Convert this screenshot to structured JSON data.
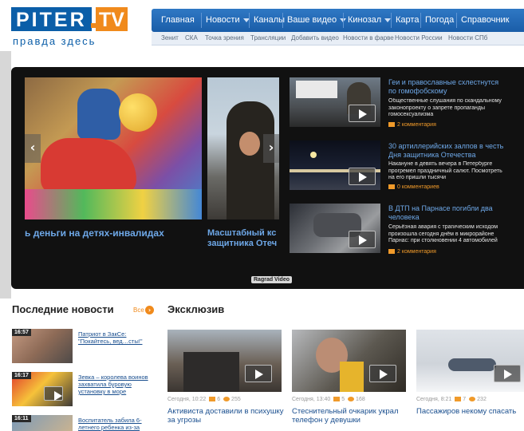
{
  "logo": {
    "name": "PITER",
    "tv": "TV",
    "tagline": "правда здесь"
  },
  "nav": {
    "items": [
      {
        "label": "Главная",
        "dropdown": false
      },
      {
        "label": "Новости",
        "dropdown": true
      },
      {
        "label": "Каналы",
        "dropdown": false
      },
      {
        "label": "Ваше видео",
        "dropdown": true
      },
      {
        "label": "Кинозал",
        "dropdown": true
      },
      {
        "label": "Карта",
        "dropdown": false
      },
      {
        "label": "Погода",
        "dropdown": false
      },
      {
        "label": "Справочник",
        "dropdown": false
      }
    ],
    "subitems": [
      "Зенит",
      "СКА",
      "Точка зрения",
      "Трансляции",
      "Добавить видео",
      "Новости в фарве",
      "Новости России",
      "Новости СПб"
    ]
  },
  "slider": {
    "slide1_caption": "ь деньги на детях-инвалидах",
    "slide2_caption_1": "Масштабный кс",
    "slide2_caption_2": "защитника Отеч",
    "prev_glyph": "‹",
    "next_glyph": "›",
    "footer_label": "Ragrad Video"
  },
  "side_news": [
    {
      "title": "Геи и православные схлестнутся по гомофобскому",
      "text": "Общественные слушания по скандальному законопроекту о запрете пропаганды гомосексуализма",
      "comments": "2 комментария"
    },
    {
      "title": "30 артиллерийских залпов в честь Дня защитника Отечества",
      "text": "Накануне в девять вечера в Петербурге прогремел праздничный салют. Посмотреть на его пришли тысячи",
      "comments": "0 комментариев"
    },
    {
      "title": "В ДТП на Парнасе погибли два человека",
      "text": "Серьёзная авария с трагическим исходом произошла сегодня днём в микрорайоне Парнас: при столкновении 4 автомобилей",
      "comments": "2 комментария"
    }
  ],
  "latest": {
    "heading": "Последние новости",
    "all_label": "Все",
    "all_glyph": "›",
    "items": [
      {
        "time": "16:57",
        "text": "Патриот в ЗакСе: \"Покайтесь, вед…сты!\""
      },
      {
        "time": "16:17",
        "text": "Зевка – королева воинов захватила буровую установку в море"
      },
      {
        "time": "16:11",
        "text": "Воспитатель забила 6-летнего ребенка из-за"
      }
    ]
  },
  "exclusive": {
    "heading": "Эксклюзив",
    "items": [
      {
        "meta_date": "Сегодня, 10:22",
        "comments": "6",
        "views": "255",
        "title": "Активиста доставили в психушку за угрозы"
      },
      {
        "meta_date": "Сегодня, 13:40",
        "comments": "5",
        "views": "168",
        "title": "Стеснительный очкарик украл телефон у девушки"
      },
      {
        "meta_date": "Сегодня, 8:21",
        "comments": "7",
        "views": "232",
        "title": "Пассажиров некому спасать"
      }
    ]
  },
  "colors": {
    "brand_blue": "#0b5ea8",
    "accent_orange": "#f08a1c",
    "link_blue": "#6ea8e8"
  }
}
